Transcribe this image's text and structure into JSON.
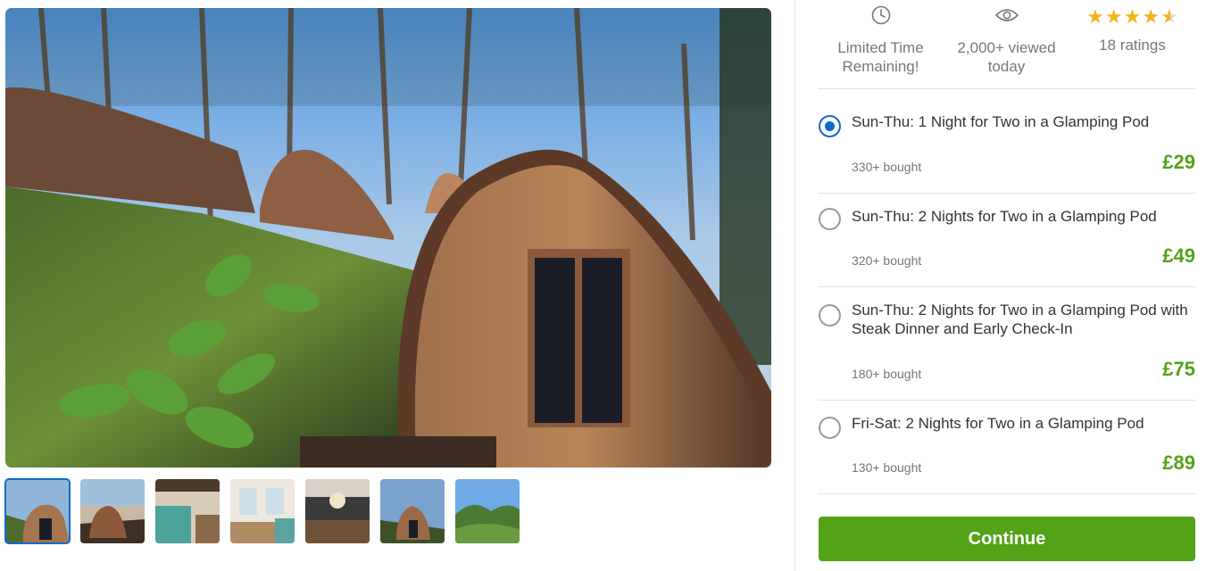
{
  "gallery": {
    "hero_alt": "glamping-pod-photo",
    "thumbnail_count": 7,
    "selected_thumbnail": 1
  },
  "stats": {
    "time_icon": "clock-icon",
    "time_text": "Limited Time Remaining!",
    "views_icon": "eye-icon",
    "views_text": "2,000+ viewed today",
    "rating_value": 4.5,
    "rating_max": 5,
    "ratings_text": "18 ratings"
  },
  "options": [
    {
      "title": "Sun-Thu: 1 Night for Two in a Glamping Pod",
      "bought": "330+ bought",
      "price": "£29",
      "selected": true
    },
    {
      "title": "Sun-Thu: 2 Nights for Two in a Glamping Pod",
      "bought": "320+ bought",
      "price": "£49",
      "selected": false
    },
    {
      "title": "Sun-Thu: 2 Nights for Two in a Glamping Pod with Steak Dinner and Early Check-In",
      "bought": "180+ bought",
      "price": "£75",
      "selected": false
    },
    {
      "title": "Fri-Sat: 2 Nights for Two in a Glamping Pod",
      "bought": "130+ bought",
      "price": "£89",
      "selected": false
    }
  ],
  "continue_label": "Continue",
  "colors": {
    "accent_green": "#53a318",
    "selected_blue": "#0a6ccf",
    "star_gold": "#f5b41e"
  }
}
